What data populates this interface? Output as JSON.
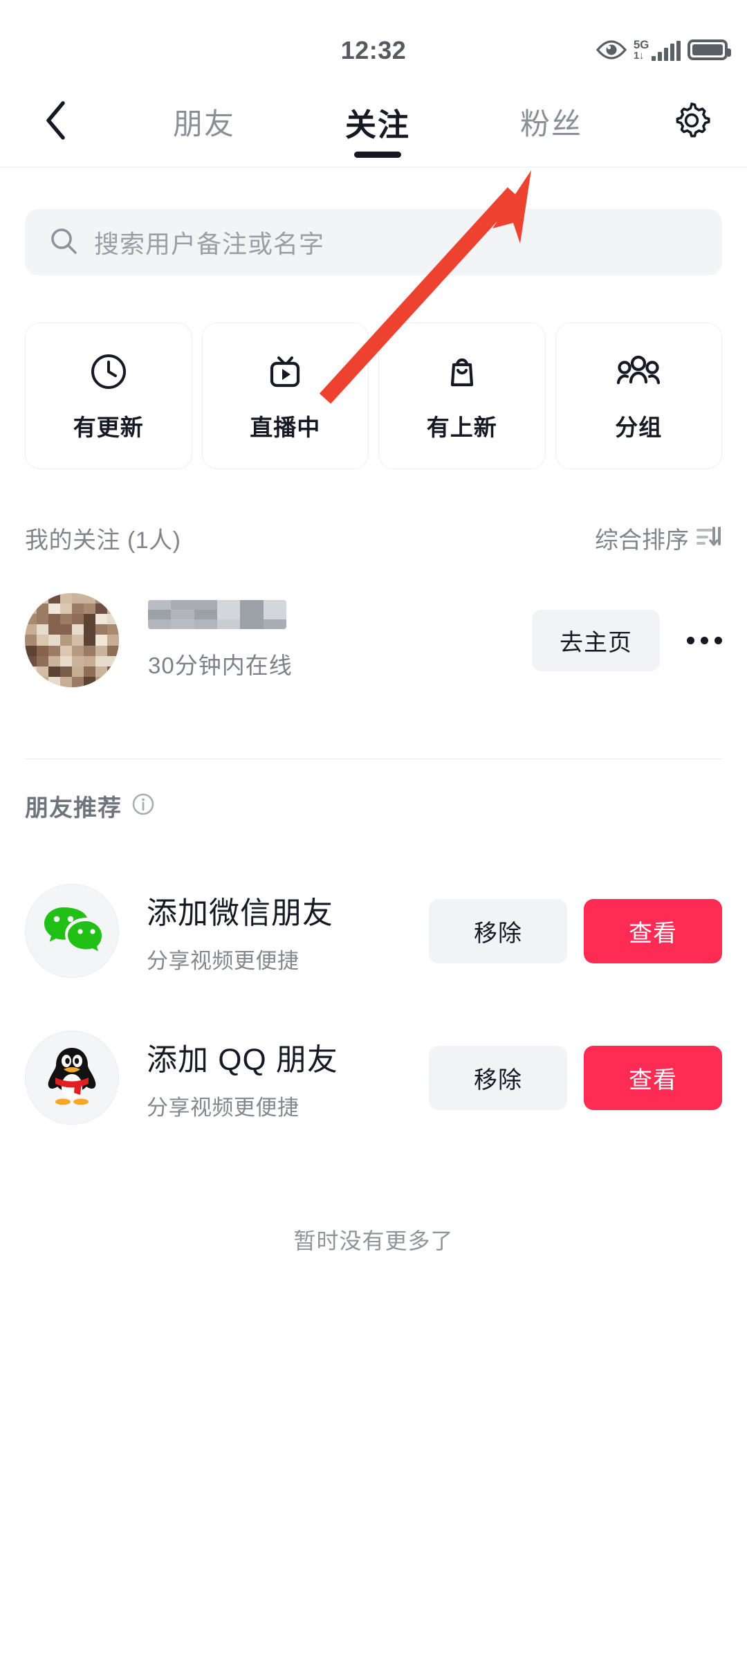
{
  "status_bar": {
    "time": "12:32",
    "network_label": "5G",
    "network_sub": "1↓",
    "icons": [
      "eye-icon",
      "signal-icon",
      "battery-icon"
    ]
  },
  "nav": {
    "back_icon": "chevron-left-icon",
    "settings_icon": "gear-icon",
    "tabs": [
      {
        "label": "朋友",
        "active": false
      },
      {
        "label": "关注",
        "active": true
      },
      {
        "label": "粉丝",
        "active": false
      }
    ]
  },
  "search": {
    "placeholder": "搜索用户备注或名字",
    "value": "",
    "icon": "search-icon"
  },
  "quick_cards": [
    {
      "label": "有更新",
      "icon": "clock-icon"
    },
    {
      "label": "直播中",
      "icon": "live-tv-icon"
    },
    {
      "label": "有上新",
      "icon": "shopping-bag-icon"
    },
    {
      "label": "分组",
      "icon": "group-people-icon"
    }
  ],
  "following_section": {
    "title": "我的关注 (1人)",
    "sort_label": "综合排序",
    "sort_icon": "sort-filter-icon",
    "rows": [
      {
        "name": "",
        "name_blurred": true,
        "status": "30分钟内在线",
        "action_label": "去主页",
        "more_icon": "more-dots-icon",
        "avatar": "blurred-user-avatar"
      }
    ]
  },
  "recommend_section": {
    "title": "朋友推荐",
    "info_icon": "info-circle-icon",
    "items": [
      {
        "icon": "wechat-icon",
        "title": "添加微信朋友",
        "subtitle": "分享视频更便捷",
        "remove_label": "移除",
        "view_label": "查看"
      },
      {
        "icon": "qq-penguin-icon",
        "title": "添加 QQ 朋友",
        "subtitle": "分享视频更便捷",
        "remove_label": "移除",
        "view_label": "查看"
      }
    ]
  },
  "footer": {
    "no_more_text": "暂时没有更多了"
  },
  "annotation": {
    "type": "arrow",
    "color": "#EE4230",
    "points_to_tab": "粉丝"
  },
  "colors": {
    "accent_red": "#FE2C55",
    "annotation_red": "#EE4230",
    "wechat_green": "#21C017",
    "text_primary": "#161823",
    "text_secondary": "#80848B",
    "chip_bg": "#F2F3F5",
    "search_bg": "#F3F4F5"
  }
}
